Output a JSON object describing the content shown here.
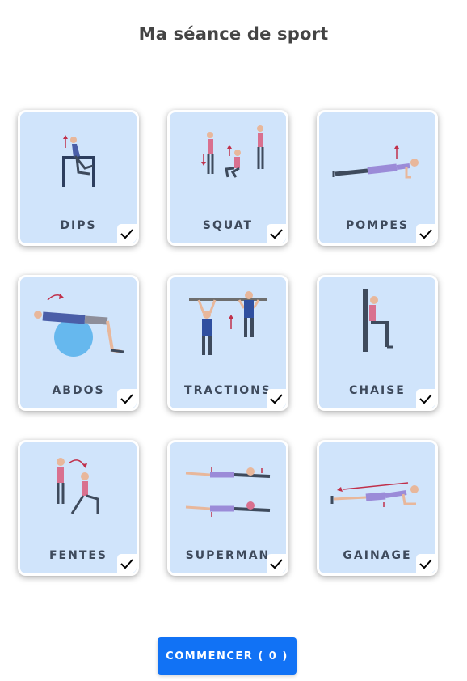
{
  "title": "Ma séance de sport",
  "exercises": [
    {
      "label": "DIPS",
      "icon": "dips-exercise-icon",
      "checked": true
    },
    {
      "label": "SQUAT",
      "icon": "squat-exercise-icon",
      "checked": true
    },
    {
      "label": "POMPES",
      "icon": "pushup-exercise-icon",
      "checked": true
    },
    {
      "label": "ABDOS",
      "icon": "abs-ball-exercise-icon",
      "checked": true
    },
    {
      "label": "TRACTIONS",
      "icon": "pullup-exercise-icon",
      "checked": true
    },
    {
      "label": "CHAISE",
      "icon": "wall-sit-exercise-icon",
      "checked": true
    },
    {
      "label": "FENTES",
      "icon": "lunge-exercise-icon",
      "checked": true
    },
    {
      "label": "SUPERMAN",
      "icon": "superman-exercise-icon",
      "checked": true
    },
    {
      "label": "GAINAGE",
      "icon": "plank-exercise-icon",
      "checked": true
    }
  ],
  "start_button": {
    "label": "COMMENCER ( 0 )"
  },
  "colors": {
    "card_bg": "#d0e4fb",
    "accent": "#1172f5",
    "label": "#3e4a5c"
  }
}
